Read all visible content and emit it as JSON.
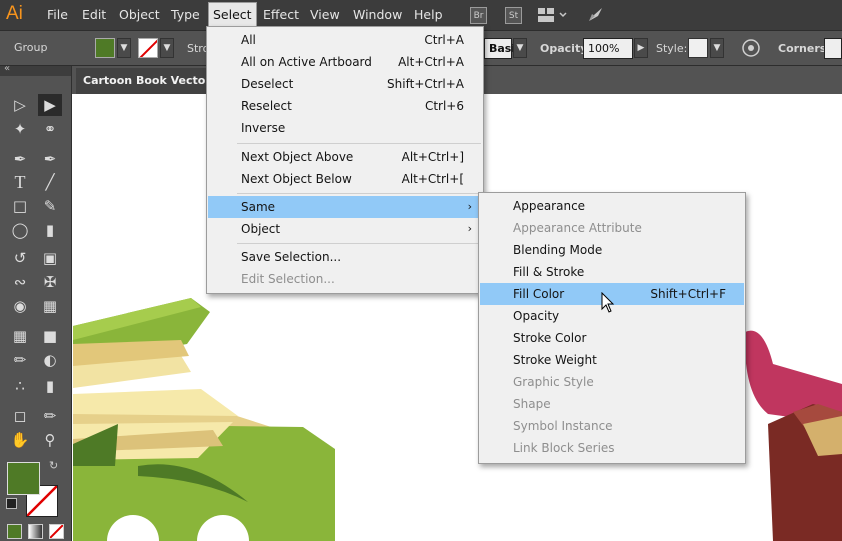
{
  "app": {
    "logo": "Ai"
  },
  "menubar": {
    "items": [
      "File",
      "Edit",
      "Object",
      "Type",
      "Select",
      "Effect",
      "View",
      "Window",
      "Help"
    ],
    "active": "Select",
    "app_icons": [
      "Br",
      "St"
    ]
  },
  "control_bar": {
    "object_type": "Group",
    "stroke_label": "Stro",
    "style_dropdown": "Basic",
    "opacity_label": "Opacity:",
    "opacity_value": "100%",
    "style_label": "Style:",
    "corners_label": "Corners:",
    "fill_color": "#4f7a26",
    "accent": "#f7941d"
  },
  "document": {
    "tab_title": "Cartoon Book Vector Se"
  },
  "select_menu": {
    "items": [
      {
        "label": "All",
        "shortcut": "Ctrl+A"
      },
      {
        "label": "All on Active Artboard",
        "shortcut": "Alt+Ctrl+A"
      },
      {
        "label": "Deselect",
        "shortcut": "Shift+Ctrl+A"
      },
      {
        "label": "Reselect",
        "shortcut": "Ctrl+6"
      },
      {
        "label": "Inverse",
        "shortcut": ""
      },
      {
        "label": "Next Object Above",
        "shortcut": "Alt+Ctrl+]"
      },
      {
        "label": "Next Object Below",
        "shortcut": "Alt+Ctrl+["
      },
      {
        "label": "Same",
        "shortcut": ""
      },
      {
        "label": "Object",
        "shortcut": ""
      },
      {
        "label": "Save Selection...",
        "shortcut": ""
      },
      {
        "label": "Edit Selection...",
        "shortcut": ""
      }
    ],
    "submenu_arrow": "›"
  },
  "same_submenu": {
    "items": [
      {
        "label": "Appearance",
        "shortcut": ""
      },
      {
        "label": "Appearance Attribute",
        "shortcut": ""
      },
      {
        "label": "Blending Mode",
        "shortcut": ""
      },
      {
        "label": "Fill & Stroke",
        "shortcut": ""
      },
      {
        "label": "Fill Color",
        "shortcut": "Shift+Ctrl+F"
      },
      {
        "label": "Opacity",
        "shortcut": ""
      },
      {
        "label": "Stroke Color",
        "shortcut": ""
      },
      {
        "label": "Stroke Weight",
        "shortcut": ""
      },
      {
        "label": "Graphic Style",
        "shortcut": ""
      },
      {
        "label": "Shape",
        "shortcut": ""
      },
      {
        "label": "Symbol Instance",
        "shortcut": ""
      },
      {
        "label": "Link Block Series",
        "shortcut": ""
      }
    ]
  },
  "colors": {
    "highlight": "#91c9f7",
    "menu_bg": "#f0f0f0",
    "chrome": "#535353"
  }
}
